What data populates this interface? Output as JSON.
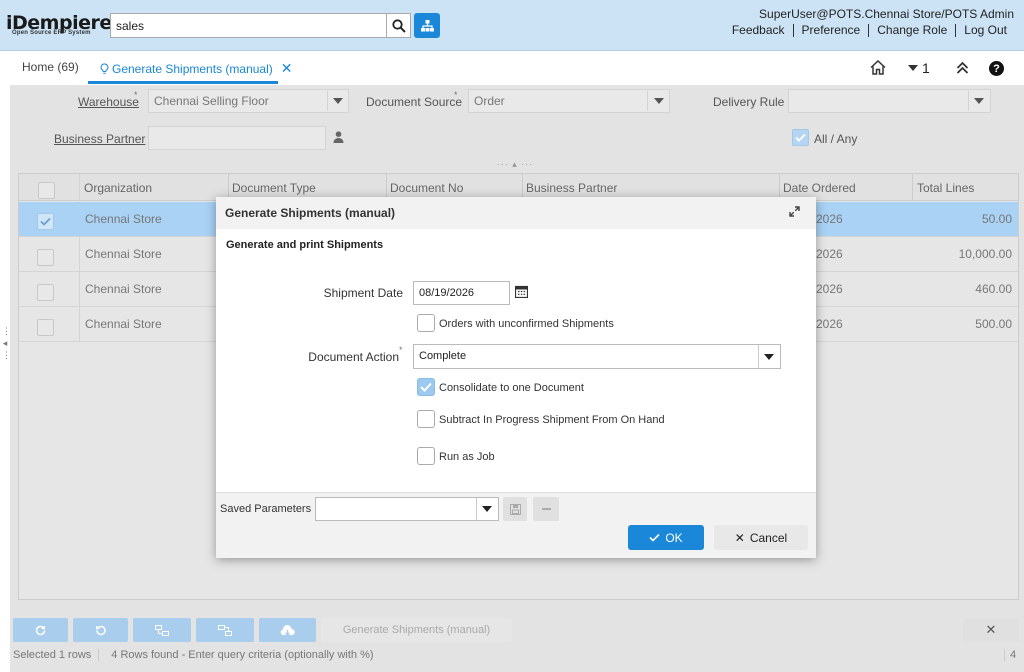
{
  "app": {
    "logo": "iDempiere",
    "logo_tagline": "Open Source ERP System"
  },
  "header": {
    "search_value": "sales",
    "user": "SuperUser@POTS.Chennai Store/POTS Admin",
    "links": [
      "Feedback",
      "Preference",
      "Change Role",
      "Log Out"
    ]
  },
  "tabs": {
    "home": "Home (69)",
    "active": "Generate Shipments (manual)",
    "counter": "1"
  },
  "params": {
    "warehouse_label": "Warehouse",
    "warehouse_value": "Chennai Selling Floor",
    "docsource_label": "Document Source",
    "docsource_value": "Order",
    "delivery_label": "Delivery Rule",
    "delivery_value": "",
    "bpartner_label": "Business Partner",
    "bpartner_value": "",
    "allany_label": "All / Any",
    "required_mark": "*"
  },
  "grid": {
    "columns": [
      "Organization",
      "Document Type",
      "Document No",
      "Business Partner",
      "Date Ordered",
      "Total Lines"
    ],
    "rows": [
      {
        "org": "Chennai Store",
        "date": "2026",
        "total": "50.00",
        "selected": true
      },
      {
        "org": "Chennai Store",
        "date": "2026",
        "total": "10,000.00",
        "selected": false
      },
      {
        "org": "Chennai Store",
        "date": "2026",
        "total": "460.00",
        "selected": false
      },
      {
        "org": "Chennai Store",
        "date": "2026",
        "total": "500.00",
        "selected": false
      }
    ]
  },
  "dialog": {
    "title": "Generate Shipments (manual)",
    "description": "Generate and print Shipments",
    "shipment_date_label": "Shipment Date",
    "shipment_date_value": "08/19/2026",
    "unconfirmed_label": "Orders with unconfirmed Shipments",
    "doc_action_label": "Document Action",
    "doc_action_value": "Complete",
    "consolidate_label": "Consolidate to one Document",
    "subtract_label": "Subtract In Progress Shipment From On Hand",
    "runjob_label": "Run as Job",
    "saved_params_label": "Saved Parameters",
    "ok_label": "OK",
    "cancel_label": "Cancel"
  },
  "toolbar": {
    "generate_label": "Generate Shipments (manual)"
  },
  "status": {
    "selected": "Selected 1 rows",
    "found": "4 Rows found - Enter query criteria (optionally with %)",
    "count": "4"
  },
  "colors": {
    "accent": "#1a87d8",
    "header_bg": "#cce3f6",
    "selection": "#a9d2f5"
  }
}
